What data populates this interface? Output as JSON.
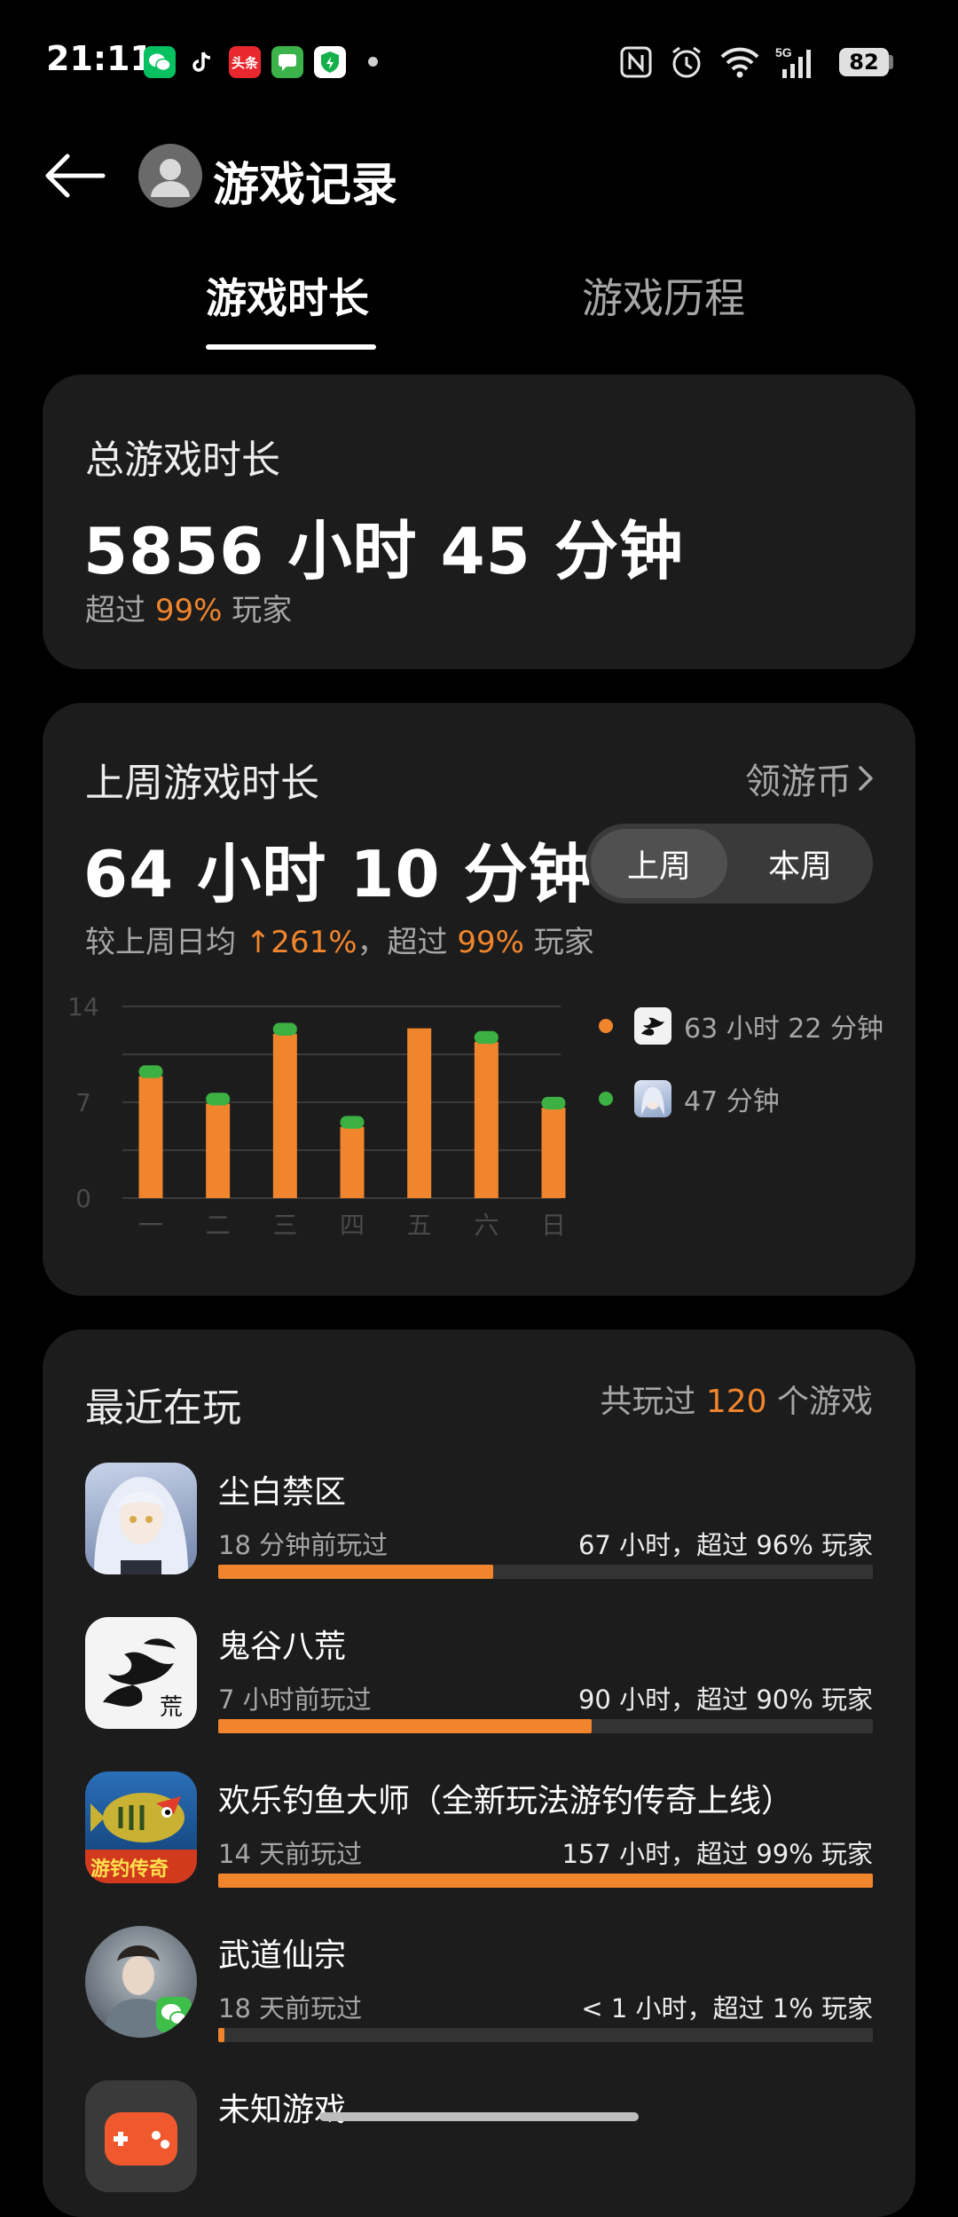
{
  "status_bar": {
    "time": "21:11",
    "notification_icons": [
      "wechat-icon",
      "douyin-icon",
      "toutiao-icon",
      "messages-icon",
      "security-icon"
    ],
    "toutiao_label": "头条",
    "network": "5G",
    "battery": "82"
  },
  "header": {
    "title": "游戏记录"
  },
  "tabs": [
    {
      "label": "游戏时长",
      "active": true
    },
    {
      "label": "游戏历程",
      "active": false
    }
  ],
  "total": {
    "heading": "总游戏时长",
    "hours": "5856",
    "hours_unit": "小时",
    "minutes": "45",
    "minutes_unit": "分钟",
    "exceed_prefix": "超过",
    "exceed_percent": "99%",
    "exceed_suffix": "玩家"
  },
  "last_week": {
    "heading": "上周游戏时长",
    "coin_link": "领游币",
    "hours": "64",
    "hours_unit": "小时",
    "minutes": "10",
    "minutes_unit": "分钟",
    "toggle": {
      "last_week": "上周",
      "this_week": "本周",
      "selected": "上周"
    },
    "compare_prefix": "较上周日均",
    "compare_value": "↑261%",
    "compare_mid": "，超过",
    "compare_percent": "99%",
    "compare_suffix": "玩家"
  },
  "chart_data": {
    "type": "bar",
    "stacked": true,
    "categories": [
      "一",
      "二",
      "三",
      "四",
      "五",
      "六",
      "日"
    ],
    "yticks": [
      "0",
      "7",
      "14"
    ],
    "ylim": [
      0,
      14
    ],
    "grid": true,
    "legend_position": "right",
    "colors": {
      "orange": "#f0852d",
      "green": "#3cb043"
    },
    "series": [
      {
        "name": "63 小时 22 分钟",
        "values": [
          8.9,
          6.9,
          12.0,
          5.2,
          12.4,
          11.4,
          6.6
        ]
      },
      {
        "name": "47 分钟",
        "values": [
          0.8,
          0.8,
          0.8,
          0.8,
          0.0,
          0.8,
          0.8
        ]
      }
    ]
  },
  "recent": {
    "heading": "最近在玩",
    "count_prefix": "共玩过",
    "count": "120",
    "count_suffix": "个游戏",
    "games": [
      {
        "name": "尘白禁区",
        "last_played": "18 分钟前玩过",
        "stat": "67 小时，超过 96% 玩家",
        "progress": 0.42
      },
      {
        "name": "鬼谷八荒",
        "last_played": "7 小时前玩过",
        "stat": "90 小时，超过 90% 玩家",
        "progress": 0.57
      },
      {
        "name": "欢乐钓鱼大师（全新玩法游钓传奇上线）",
        "last_played": "14 天前玩过",
        "stat": "157 小时，超过 99% 玩家",
        "progress": 1.0,
        "icon_text": "游钓传奇"
      },
      {
        "name": "武道仙宗",
        "last_played": "18 天前玩过",
        "stat": "< 1 小时，超过 1% 玩家",
        "progress": 0.01
      },
      {
        "name": "未知游戏"
      }
    ]
  }
}
